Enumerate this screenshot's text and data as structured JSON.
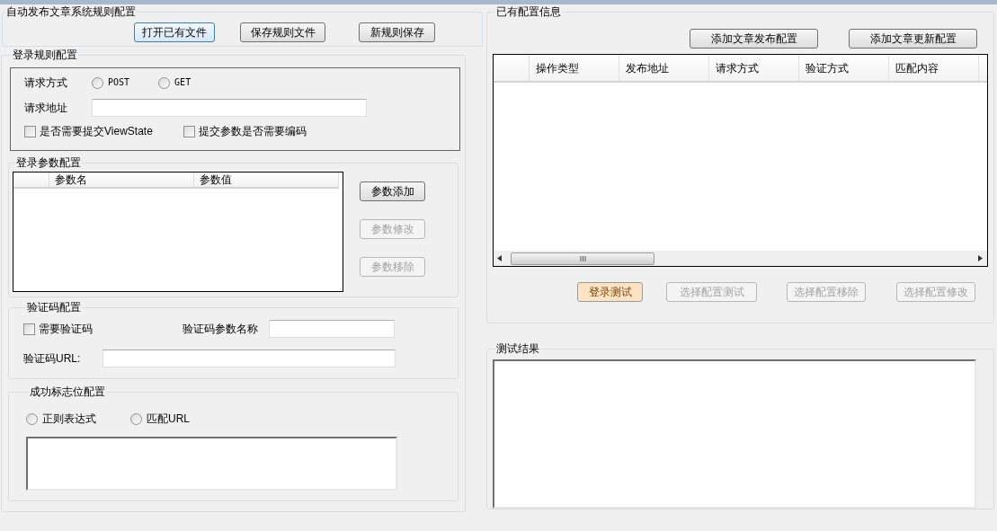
{
  "rule_file_group": {
    "title": "自动发布文章系统规则配置",
    "buttons": [
      {
        "label": "打开已有文件",
        "disabled": false,
        "focused": true
      },
      {
        "label": "保存规则文件",
        "disabled": false,
        "focused": false
      },
      {
        "label": "新规则保存",
        "disabled": false,
        "focused": false
      }
    ]
  },
  "login_rule_group": {
    "title": "登录规则配置",
    "request_method_label": "请求方式",
    "methods": [
      {
        "label": "POST",
        "selected": false
      },
      {
        "label": "GET",
        "selected": false
      }
    ],
    "request_url_label": "请求地址",
    "options": [
      {
        "label": "是否需要提交ViewState",
        "checked": false
      },
      {
        "label": "提交参数是否需要编码",
        "checked": false
      }
    ],
    "params_group": {
      "title": "登录参数配置",
      "columns": [
        "参数名",
        "参数值"
      ],
      "buttons": [
        {
          "label": "参数添加",
          "disabled": false
        },
        {
          "label": "参数修改",
          "disabled": true
        },
        {
          "label": "参数移除",
          "disabled": true
        }
      ]
    },
    "captcha_group": {
      "title": "验证码配置",
      "need_captcha": {
        "label": "需要验证码",
        "checked": false
      },
      "param_name_label": "验证码参数名称",
      "url_label": "验证码URL:"
    },
    "success_flag_group": {
      "title": "成功标志位配置",
      "modes": [
        {
          "label": "正则表达式",
          "selected": false
        },
        {
          "label": "匹配URL",
          "selected": false
        }
      ]
    }
  },
  "config_info_group": {
    "title": "已有配置信息",
    "buttons": [
      {
        "label": "添加文章发布配置",
        "disabled": false
      },
      {
        "label": "添加文章更新配置",
        "disabled": false
      }
    ],
    "table": {
      "columns": [
        "操作类型",
        "发布地址",
        "请求方式",
        "验证方式",
        "匹配内容"
      ]
    },
    "actions": [
      {
        "label": "登录测试",
        "disabled": false,
        "highlighted": true
      },
      {
        "label": "选择配置测试",
        "disabled": true,
        "highlighted": false
      },
      {
        "label": "选择配置移除",
        "disabled": true,
        "highlighted": false
      },
      {
        "label": "选择配置修改",
        "disabled": true,
        "highlighted": false
      }
    ]
  },
  "test_result_group": {
    "title": "测试结果"
  }
}
